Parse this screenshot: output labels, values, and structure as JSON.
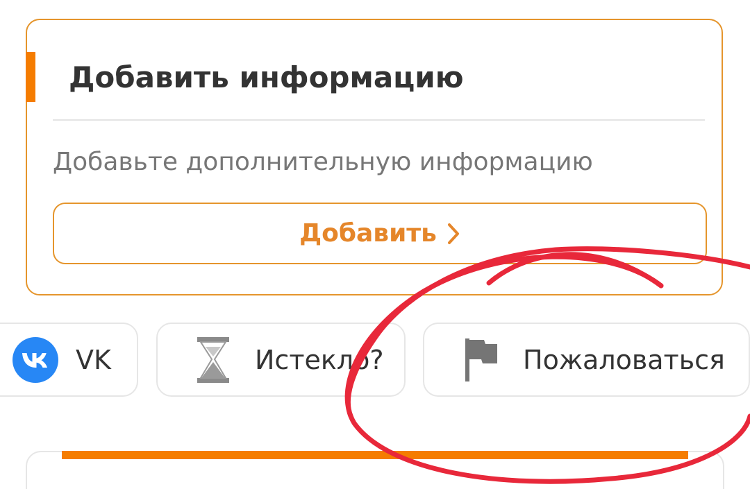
{
  "info_card": {
    "title": "Добавить информацию",
    "description": "Добавьте дополнительную информацию",
    "add_button_label": "Добавить"
  },
  "actions": {
    "vk_label": "VK",
    "expired_label": "Истекло?",
    "report_label": "Пожаловаться"
  },
  "icons": {
    "vk": "vk-logo-icon",
    "expired": "hourglass-icon",
    "report": "flag-icon",
    "add": "chevron-right-icon"
  },
  "colors": {
    "accent": "#F57C00",
    "card_border": "#E5952C",
    "button_text": "#E5862A",
    "vk_blue": "#2787F5",
    "icon_gray": "#757575",
    "annotation_red": "#E8283A"
  }
}
